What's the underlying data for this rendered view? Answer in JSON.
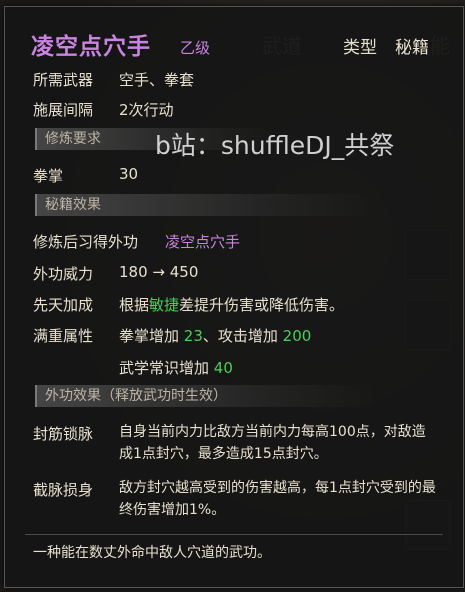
{
  "background": {
    "tabs": [
      "武道",
      "能"
    ]
  },
  "tooltip": {
    "title": "凌空点穴手",
    "grade": "乙级",
    "type_label": "类型",
    "type_value": "秘籍",
    "weapon_label": "所需武器",
    "weapon_value": "空手、拳套",
    "interval_label": "施展间隔",
    "interval_value": "2次行动",
    "section_requirements": "修炼要求",
    "req_label": "拳掌",
    "req_value": "30",
    "section_effect": "秘籍效果",
    "learn_label": "修炼后习得外功",
    "learn_value": "凌空点穴手",
    "power_label": "外功威力",
    "power_value": "180 → 450",
    "innate_label": "先天加成",
    "innate_pre": "根据",
    "innate_hl": "敏捷",
    "innate_post": "差提升伤害或降低伤害。",
    "full_label": "满重属性",
    "full_line1_pre": "拳掌增加 ",
    "full_line1_v1": "23",
    "full_line1_mid": "、攻击增加 ",
    "full_line1_v2": "200",
    "full_line2_pre": "武学常识增加 ",
    "full_line2_v": "40",
    "section_external": "外功效果（释放武功时生效）",
    "effect1_label": "封筋锁脉",
    "effect1_text": "自身当前内力比敌方当前内力每高100点，对敌造成1点封穴，最多造成15点封穴。",
    "effect2_label": "截脉损身",
    "effect2_text": "敌方封穴越高受到的伤害越高，每1点封穴受到的最终伤害增加1%。",
    "description": "一种能在数丈外命中敌人穴道的武功。"
  },
  "watermark": "b站：shuffleDJ_共祭"
}
